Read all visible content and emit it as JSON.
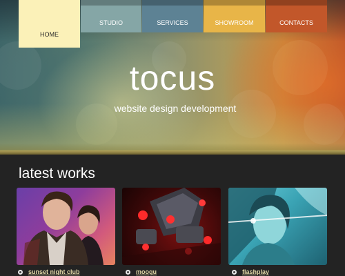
{
  "brand": {
    "logo_text": "tocus",
    "tagline": "website design development"
  },
  "nav": {
    "items": [
      {
        "label": "HOME",
        "active": true,
        "color": "#fbf1b8"
      },
      {
        "label": "STUDIO",
        "active": false,
        "color": "#85a6a6"
      },
      {
        "label": "SERVICES",
        "active": false,
        "color": "#5d8294"
      },
      {
        "label": "SHOWROOM",
        "active": false,
        "color": "#e8b548"
      },
      {
        "label": "CONTACTS",
        "active": false,
        "color": "#c2572a"
      }
    ]
  },
  "works": {
    "heading": "latest works",
    "items": [
      {
        "caption": "sunset night club",
        "image": "people-portrait-photo",
        "bullet_icon": "circle-bullet-icon"
      },
      {
        "caption": "moogu",
        "image": "robot-render-photo",
        "bullet_icon": "circle-bullet-icon"
      },
      {
        "caption": "flashplay",
        "image": "woman-portrait-cyan-photo",
        "bullet_icon": "circle-bullet-icon"
      }
    ]
  },
  "colors": {
    "background": "#232323",
    "caption_text": "#e0d7a5",
    "hero_accent_orange": "#c88a3e"
  }
}
